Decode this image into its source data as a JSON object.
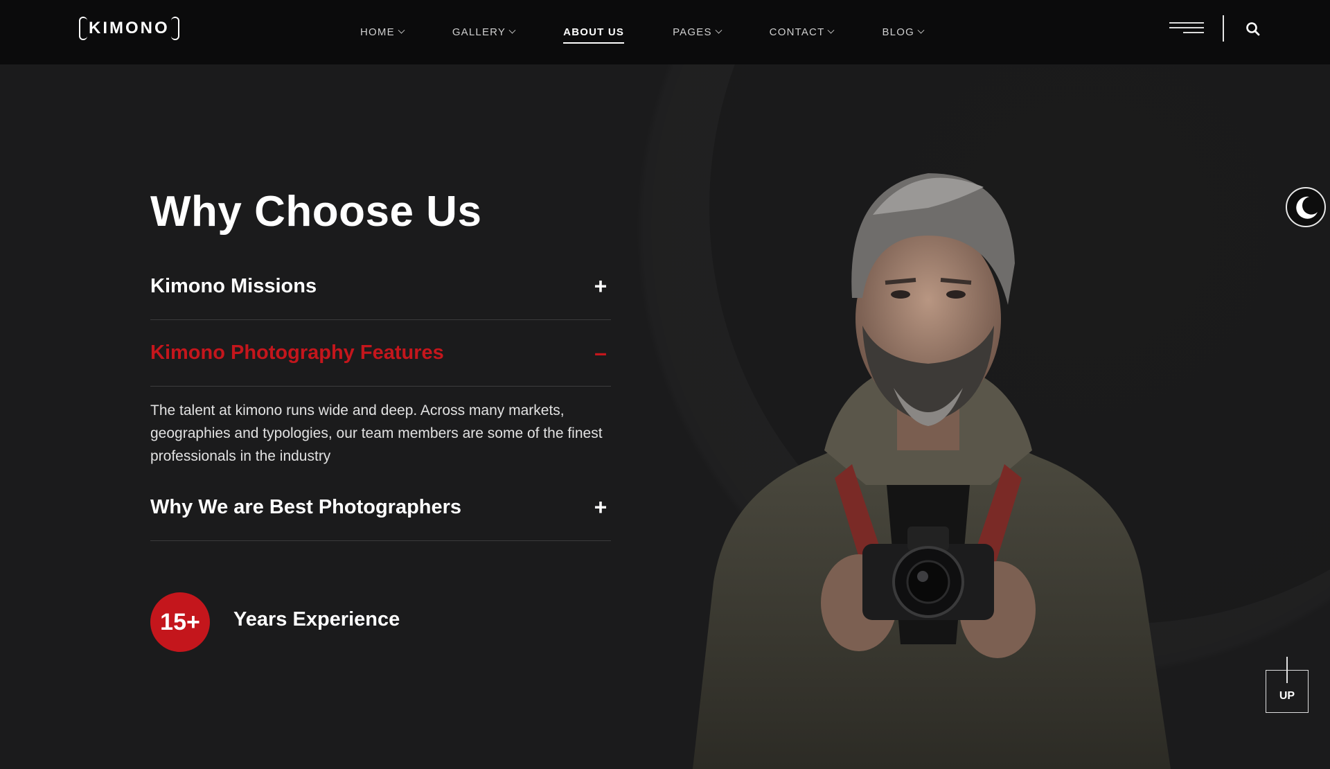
{
  "header": {
    "logo_text": "KIMONO",
    "nav": [
      {
        "label": "HOME",
        "has_dropdown": true
      },
      {
        "label": "GALLERY",
        "has_dropdown": true
      },
      {
        "label": "ABOUT US",
        "has_dropdown": false,
        "active": true
      },
      {
        "label": "PAGES",
        "has_dropdown": true
      },
      {
        "label": "CONTACT",
        "has_dropdown": true
      },
      {
        "label": "BLOG",
        "has_dropdown": true
      }
    ],
    "icons": [
      "hamburger-menu-icon",
      "search-icon"
    ]
  },
  "main": {
    "title": "Why Choose Us",
    "accordion": [
      {
        "label": "Kimono Missions",
        "sign": "+",
        "open": false
      },
      {
        "label": "Kimono Photography Features",
        "sign": "–",
        "open": true,
        "body": "The talent at kimono runs wide and deep. Across many markets, geographies and typologies, our team members are some of the finest professionals in the industry"
      },
      {
        "label": "Why We are Best Photographers",
        "sign": "+",
        "open": false
      }
    ],
    "experience": {
      "value": "15+",
      "label": "Years Experience"
    }
  },
  "floating": {
    "dark_mode_icon": "moon-icon",
    "up_label": "UP"
  },
  "colors": {
    "accent": "#c4161c",
    "background": "#1b1b1c",
    "header": "#0b0b0c"
  }
}
